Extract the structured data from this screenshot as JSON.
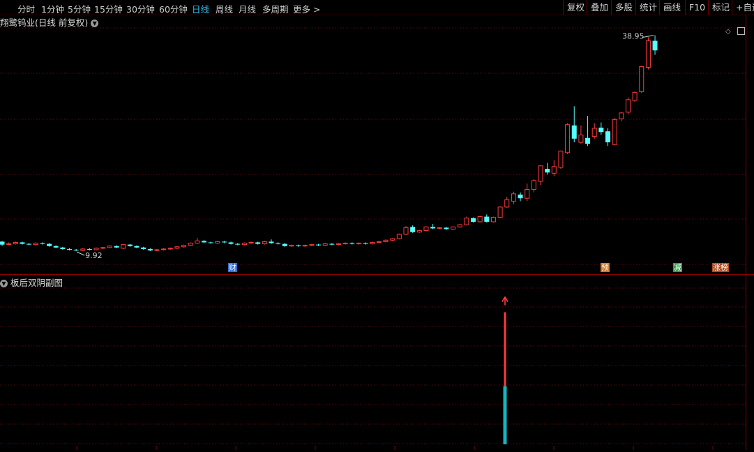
{
  "toolbar": {
    "timeframes": [
      "分时",
      "1分钟",
      "5分钟",
      "15分钟",
      "30分钟",
      "60分钟",
      "日线",
      "周线",
      "月线",
      "多周期",
      "更多 >"
    ],
    "active": "日线",
    "right_buttons": [
      "复权",
      "叠加",
      "多股",
      "统计",
      "画线",
      "F10",
      "标记",
      "+自选"
    ]
  },
  "chart": {
    "title": "翔鹭钨业(日线 前复权)",
    "high_label": "38.95",
    "low_label": "9.92",
    "markers": [
      {
        "label": "财",
        "color": "#2f6bd8"
      },
      {
        "label": "预",
        "color": "#d0701c"
      },
      {
        "label": "减",
        "color": "#2e9a4a"
      },
      {
        "label": "涨榜",
        "color": "#b0461a"
      }
    ],
    "colors": {
      "up": "#ff3b3b",
      "down": "#54ffff",
      "grid": "#7a0000",
      "bg": "#000000"
    }
  },
  "subchart": {
    "title": "板后双阴副图",
    "signal": {
      "red_top": 0.82,
      "cyan_top": 0.36
    }
  },
  "chart_data": {
    "type": "candlestick",
    "ylim": [
      8,
      41
    ],
    "candles": [
      [
        10.9,
        10.5,
        11.0,
        10.3
      ],
      [
        10.5,
        10.6,
        10.8,
        10.4
      ],
      [
        10.6,
        10.8,
        10.9,
        10.5
      ],
      [
        10.8,
        10.6,
        10.9,
        10.5
      ],
      [
        10.6,
        10.5,
        10.7,
        10.4
      ],
      [
        10.5,
        10.7,
        10.8,
        10.4
      ],
      [
        10.7,
        10.6,
        10.8,
        10.5
      ],
      [
        10.6,
        10.3,
        10.7,
        10.2
      ],
      [
        10.3,
        10.1,
        10.4,
        10.0
      ],
      [
        10.1,
        9.9,
        10.2,
        9.8
      ],
      [
        9.9,
        9.8,
        10.0,
        9.7
      ],
      [
        9.8,
        9.7,
        9.9,
        9.6
      ],
      [
        9.7,
        9.9,
        10.0,
        9.6
      ],
      [
        9.9,
        9.8,
        10.0,
        9.7
      ],
      [
        9.8,
        10.0,
        10.1,
        9.7
      ],
      [
        10.0,
        10.1,
        10.2,
        9.9
      ],
      [
        10.1,
        10.3,
        10.4,
        10.0
      ],
      [
        10.3,
        10.1,
        10.4,
        10.0
      ],
      [
        10.0,
        10.5,
        10.6,
        9.9
      ],
      [
        10.5,
        10.3,
        10.6,
        10.2
      ],
      [
        10.3,
        10.1,
        10.4,
        10.0
      ],
      [
        10.1,
        9.9,
        10.2,
        9.8
      ],
      [
        9.9,
        9.7,
        10.0,
        9.6
      ],
      [
        9.7,
        9.8,
        9.9,
        9.6
      ],
      [
        9.8,
        9.9,
        10.0,
        9.7
      ],
      [
        9.9,
        10.0,
        10.1,
        9.8
      ],
      [
        10.0,
        10.2,
        10.3,
        9.9
      ],
      [
        10.2,
        10.4,
        10.5,
        10.1
      ],
      [
        10.4,
        10.7,
        10.8,
        10.3
      ],
      [
        10.7,
        11.0,
        11.4,
        10.6
      ],
      [
        11.0,
        10.8,
        11.1,
        10.7
      ],
      [
        10.8,
        10.7,
        10.9,
        10.6
      ],
      [
        10.7,
        10.9,
        11.0,
        10.6
      ],
      [
        10.9,
        10.8,
        11.0,
        10.7
      ],
      [
        10.8,
        10.6,
        10.9,
        10.5
      ],
      [
        10.6,
        10.5,
        10.7,
        10.4
      ],
      [
        10.5,
        10.7,
        10.8,
        10.4
      ],
      [
        10.7,
        10.8,
        10.9,
        10.6
      ],
      [
        10.8,
        10.6,
        10.9,
        10.5
      ],
      [
        10.6,
        10.9,
        11.0,
        10.5
      ],
      [
        10.9,
        10.7,
        11.2,
        10.6
      ],
      [
        10.7,
        10.6,
        10.8,
        10.5
      ],
      [
        10.6,
        10.3,
        10.7,
        10.2
      ],
      [
        10.3,
        10.4,
        10.5,
        10.2
      ],
      [
        10.4,
        10.3,
        10.5,
        10.2
      ],
      [
        10.3,
        10.4,
        10.5,
        10.2
      ],
      [
        10.4,
        10.5,
        10.6,
        10.3
      ],
      [
        10.5,
        10.4,
        10.6,
        10.3
      ],
      [
        10.4,
        10.6,
        10.7,
        10.3
      ],
      [
        10.6,
        10.5,
        10.7,
        10.4
      ],
      [
        10.5,
        10.6,
        10.7,
        10.4
      ],
      [
        10.6,
        10.7,
        10.8,
        10.5
      ],
      [
        10.7,
        10.6,
        10.8,
        10.5
      ],
      [
        10.6,
        10.7,
        10.8,
        10.5
      ],
      [
        10.7,
        10.6,
        10.8,
        10.5
      ],
      [
        10.6,
        10.8,
        10.9,
        10.5
      ],
      [
        10.8,
        10.9,
        11.0,
        10.7
      ],
      [
        10.9,
        11.1,
        11.2,
        10.8
      ],
      [
        11.1,
        11.3,
        11.4,
        11.0
      ],
      [
        11.3,
        11.9,
        12.0,
        11.2
      ],
      [
        11.9,
        12.8,
        13.0,
        11.8
      ],
      [
        12.9,
        12.2,
        13.1,
        12.1
      ],
      [
        12.2,
        12.4,
        12.5,
        12.1
      ],
      [
        12.4,
        12.9,
        13.0,
        12.3
      ],
      [
        12.9,
        12.7,
        13.3,
        12.6
      ],
      [
        12.7,
        12.8,
        12.9,
        12.6
      ],
      [
        12.8,
        12.6,
        12.9,
        12.5
      ],
      [
        12.6,
        12.9,
        13.0,
        12.5
      ],
      [
        12.9,
        13.2,
        13.3,
        12.8
      ],
      [
        13.2,
        14.1,
        14.3,
        13.1
      ],
      [
        14.1,
        13.6,
        14.2,
        13.5
      ],
      [
        13.6,
        14.3,
        14.4,
        13.5
      ],
      [
        14.3,
        13.6,
        14.6,
        13.5
      ],
      [
        13.6,
        14.2,
        14.3,
        13.5
      ],
      [
        14.2,
        15.6,
        15.7,
        14.1
      ],
      [
        15.6,
        16.6,
        17.0,
        15.5
      ],
      [
        16.4,
        17.4,
        17.7,
        16.0
      ],
      [
        17.3,
        16.8,
        17.6,
        16.4
      ],
      [
        16.8,
        18.0,
        18.8,
        16.4
      ],
      [
        18.0,
        19.2,
        19.4,
        17.6
      ],
      [
        19.1,
        21.2,
        21.3,
        18.6
      ],
      [
        20.8,
        20.3,
        21.6,
        20.0
      ],
      [
        20.2,
        21.1,
        22.0,
        19.8
      ],
      [
        21.0,
        23.2,
        23.3,
        20.8
      ],
      [
        23.0,
        26.8,
        27.0,
        22.8
      ],
      [
        26.7,
        24.9,
        29.3,
        24.4
      ],
      [
        24.4,
        25.4,
        26.7,
        24.2
      ],
      [
        25.0,
        24.2,
        28.0,
        23.9
      ],
      [
        25.2,
        26.3,
        27.0,
        24.9
      ],
      [
        26.4,
        25.8,
        27.1,
        25.4
      ],
      [
        25.9,
        24.4,
        26.3,
        23.9
      ],
      [
        24.1,
        27.5,
        27.7,
        24.0
      ],
      [
        27.6,
        28.4,
        28.5,
        27.3
      ],
      [
        28.5,
        30.2,
        30.5,
        28.2
      ],
      [
        30.1,
        31.2,
        31.3,
        29.9
      ],
      [
        31.3,
        34.7,
        34.8,
        31.1
      ],
      [
        34.6,
        38.2,
        38.7,
        34.3
      ],
      [
        38.2,
        36.9,
        38.95,
        36.3
      ]
    ]
  }
}
